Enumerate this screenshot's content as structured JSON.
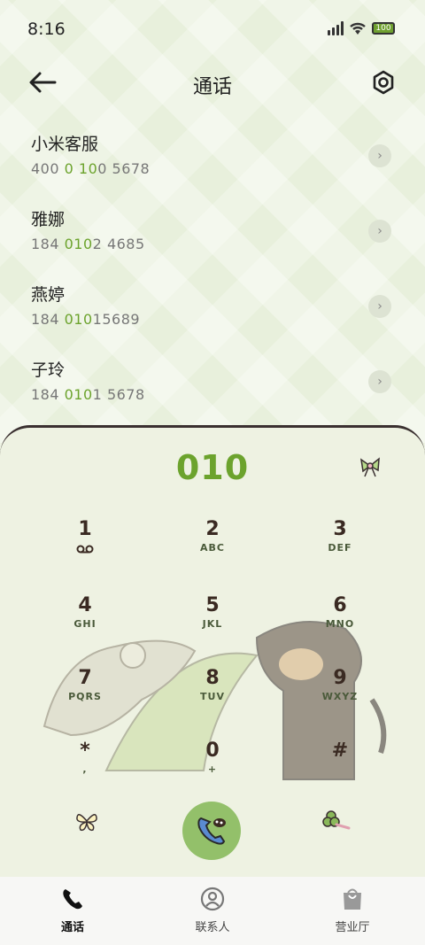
{
  "status": {
    "time": "8:16",
    "battery": "100"
  },
  "header": {
    "title": "通话"
  },
  "recents": [
    {
      "name": "小米客服",
      "num_pre": "400 ",
      "num_hl": "0 10",
      "num_post": "0 5678"
    },
    {
      "name": "雅娜",
      "num_pre": "184 ",
      "num_hl": "010",
      "num_post": "2 4685"
    },
    {
      "name": "燕婷",
      "num_pre": "184 ",
      "num_hl": "010",
      "num_post": "15689"
    },
    {
      "name": "子玲",
      "num_pre": "184 ",
      "num_hl": "010",
      "num_post": "1 5678"
    }
  ],
  "dialer": {
    "display": "010",
    "keys": [
      {
        "digit": "1",
        "letters": ""
      },
      {
        "digit": "2",
        "letters": "ABC"
      },
      {
        "digit": "3",
        "letters": "DEF"
      },
      {
        "digit": "4",
        "letters": "GHI"
      },
      {
        "digit": "5",
        "letters": "JKL"
      },
      {
        "digit": "6",
        "letters": "MNO"
      },
      {
        "digit": "7",
        "letters": "PQRS"
      },
      {
        "digit": "8",
        "letters": "TUV"
      },
      {
        "digit": "9",
        "letters": "WXYZ"
      },
      {
        "digit": "*",
        "letters": ","
      },
      {
        "digit": "0",
        "letters": "+"
      },
      {
        "digit": "#",
        "letters": ""
      }
    ]
  },
  "nav": {
    "calls": "通话",
    "contacts": "联系人",
    "store": "营业厅"
  },
  "colors": {
    "accent": "#6ca32d",
    "call_button": "#93c06a",
    "background": "#eef3e3"
  }
}
